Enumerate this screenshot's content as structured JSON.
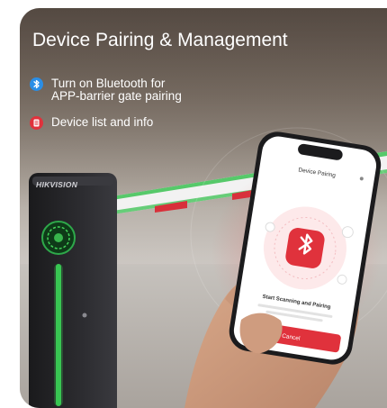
{
  "header": {
    "title": "Device Pairing & Management"
  },
  "features": [
    {
      "icon": "bluetooth-icon",
      "label": "Turn on Bluetooth for",
      "label_line2": "APP-barrier gate pairing"
    },
    {
      "icon": "device-list-icon",
      "label": "Device list and info"
    }
  ],
  "brand": {
    "name": "HIKVISION"
  },
  "phone": {
    "screen_title": "Device Pairing",
    "status_text": "Start Scanning and Pairing",
    "button_label": "Cancel"
  },
  "colors": {
    "accent_red": "#e0323c",
    "bluetooth_blue": "#2a8ee6",
    "gate_green": "#44d35a"
  }
}
